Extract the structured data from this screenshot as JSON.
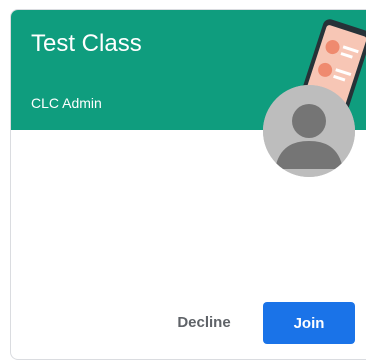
{
  "class_card": {
    "title": "Test Class",
    "owner": "CLC Admin",
    "header_color": "#0f9d7e",
    "illustration": "phone-illustration",
    "avatar": "default-avatar-icon"
  },
  "actions": {
    "decline_label": "Decline",
    "join_label": "Join",
    "join_color": "#1a73e8"
  }
}
